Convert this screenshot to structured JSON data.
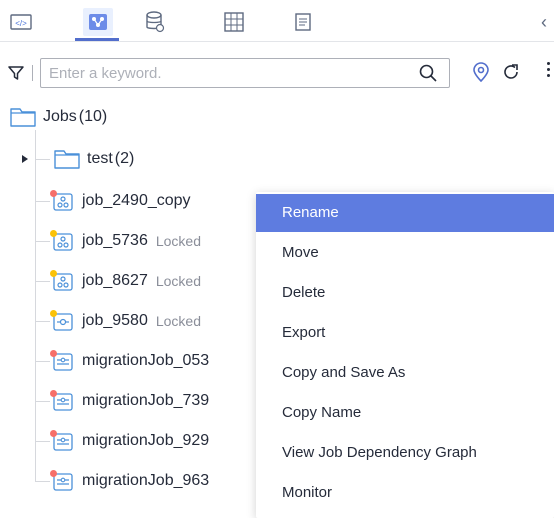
{
  "toolbar": {
    "icons": [
      "code-icon",
      "job-network-icon",
      "database-icon",
      "grid-icon",
      "document-icon"
    ],
    "active_index": 1
  },
  "search": {
    "placeholder": "Enter a keyword.",
    "value": ""
  },
  "tree": {
    "root": {
      "label": "Jobs",
      "count": "(10)"
    },
    "folder": {
      "label": "test",
      "count": "(2)"
    },
    "jobs": [
      {
        "name": "job_2490_copy",
        "status": "",
        "status_color": "#f66f6a"
      },
      {
        "name": "job_5736",
        "status": "Locked",
        "status_color": "#fac20a"
      },
      {
        "name": "job_8627",
        "status": "Locked",
        "status_color": "#fac20a"
      },
      {
        "name": "job_9580",
        "status": "Locked",
        "status_color": "#fac20a"
      },
      {
        "name": "migrationJob_053",
        "status": "",
        "status_color": "#f66f6a"
      },
      {
        "name": "migrationJob_739",
        "status": "",
        "status_color": "#f66f6a"
      },
      {
        "name": "migrationJob_929",
        "status": "",
        "status_color": "#f66f6a"
      },
      {
        "name": "migrationJob_963",
        "status": "",
        "status_color": "#f66f6a"
      }
    ]
  },
  "context_menu": {
    "items": [
      "Rename",
      "Move",
      "Delete",
      "Export",
      "Copy and Save As",
      "Copy Name",
      "View Job Dependency Graph",
      "Monitor"
    ],
    "highlighted_index": 0
  },
  "colors": {
    "accent": "#526ecc",
    "menu_highlight": "#5e7ce0",
    "folder": "#4a90d9",
    "locate": "#526ecc"
  }
}
